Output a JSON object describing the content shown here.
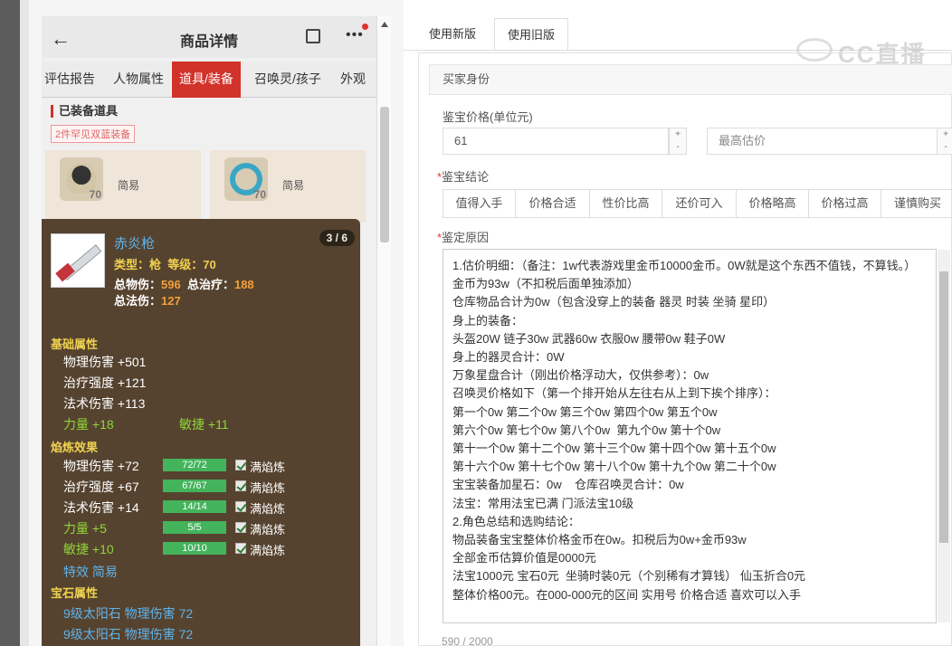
{
  "phone": {
    "title": "商品详情",
    "back_icon": "back-arrow-icon",
    "tabs": [
      "评估报告",
      "人物属性",
      "道具/装备",
      "召唤灵/孩子",
      "外观"
    ],
    "active_tab": "道具/装备",
    "section_title": "已装备道具",
    "rare_badge": "2件罕见双蓝装备",
    "items": [
      {
        "level": "70",
        "name": "简易"
      },
      {
        "level": "70",
        "name": "简易"
      }
    ],
    "tooltip": {
      "counter": "3 / 6",
      "name": "赤炎枪",
      "type_label": "类型：",
      "type_value": "枪",
      "level_label": "等级：",
      "level_value": "70",
      "total_phys_label": "总物伤：",
      "total_phys_value": "596",
      "total_heal_label": "总治疗：",
      "total_heal_value": "188",
      "total_magic_label": "总法伤：",
      "total_magic_value": "127",
      "base_title": "基础属性",
      "base": [
        "物理伤害 +501",
        "治疗强度 +121",
        "法术伤害 +113"
      ],
      "base_green": [
        "力量 +18",
        "敏捷 +11"
      ],
      "refine_title": "焰炼效果",
      "refine": [
        {
          "label": "物理伤害 +72",
          "bar": "72/72",
          "fill": 1.0,
          "tag": "满焰炼",
          "green": false
        },
        {
          "label": "治疗强度 +67",
          "bar": "67/67",
          "fill": 1.0,
          "tag": "满焰炼",
          "green": false
        },
        {
          "label": "法术伤害 +14",
          "bar": "14/14",
          "fill": 1.0,
          "tag": "满焰炼",
          "green": false
        },
        {
          "label": "力量 +5",
          "bar": "5/5",
          "fill": 1.0,
          "tag": "满焰炼",
          "green": true
        },
        {
          "label": "敏捷 +10",
          "bar": "10/10",
          "fill": 1.0,
          "tag": "满焰炼",
          "green": true
        }
      ],
      "special": "特效 简易",
      "gem_title": "宝石属性",
      "gems": [
        "9级太阳石 物理伤害 72",
        "9级太阳石 物理伤害 72"
      ]
    }
  },
  "right": {
    "tabs": [
      "使用新版",
      "使用旧版"
    ],
    "active_tab": "使用旧版",
    "watermark": "CC直播",
    "panel_header": "买家身份",
    "price_label": "鉴宝价格(单位元)",
    "price_value": "61",
    "max_price_placeholder": "最高估价",
    "conclusion_label": "鉴宝结论",
    "conclusions": [
      "值得入手",
      "价格合适",
      "性价比高",
      "还价可入",
      "价格略高",
      "价格过高",
      "谨慎购买"
    ],
    "reason_label": "鉴定原因",
    "reason_text": "1.估价明细：（备注：1w代表游戏里金币10000金币。0W就是这个东西不值钱，不算钱。）\n金币为93w（不扣税后面单独添加）\n仓库物品合计为0w（包含没穿上的装备 器灵 时装 坐骑 星印）\n身上的装备：\n头盔20W 链子30w 武器60w 衣服0w 腰带0w 鞋子0W\n身上的器灵合计：0W\n万象星盘合计（刚出价格浮动大，仅供参考）：0w\n召唤灵价格如下（第一个排开始从左往右从上到下挨个排序）：\n第一个0w 第二个0w 第三个0w 第四个0w 第五个0w\n第六个0w 第七个0w 第八个0w  第九个0w 第十个0w\n第十一个0w 第十二个0w 第十三个0w 第十四个0w 第十五个0w\n第十六个0w 第十七个0w 第十八个0w 第十九个0w 第二十个0w\n宝宝装备加星石：0w    仓库召唤灵合计：0w\n法宝：常用法宝已满 门派法宝10级\n2.角色总结和选购结论：\n物品装备宝宝整体价格金币在0w。扣税后为0w+金币93w\n全部金币估算价值是0000元\n法宝1000元 宝石0元  坐骑时装0元（个别稀有才算钱） 仙玉折合0元\n整体价格00元。在000-000元的区间 实用号 价格合适 喜欢可以入手",
    "counter": "590 / 2000"
  }
}
